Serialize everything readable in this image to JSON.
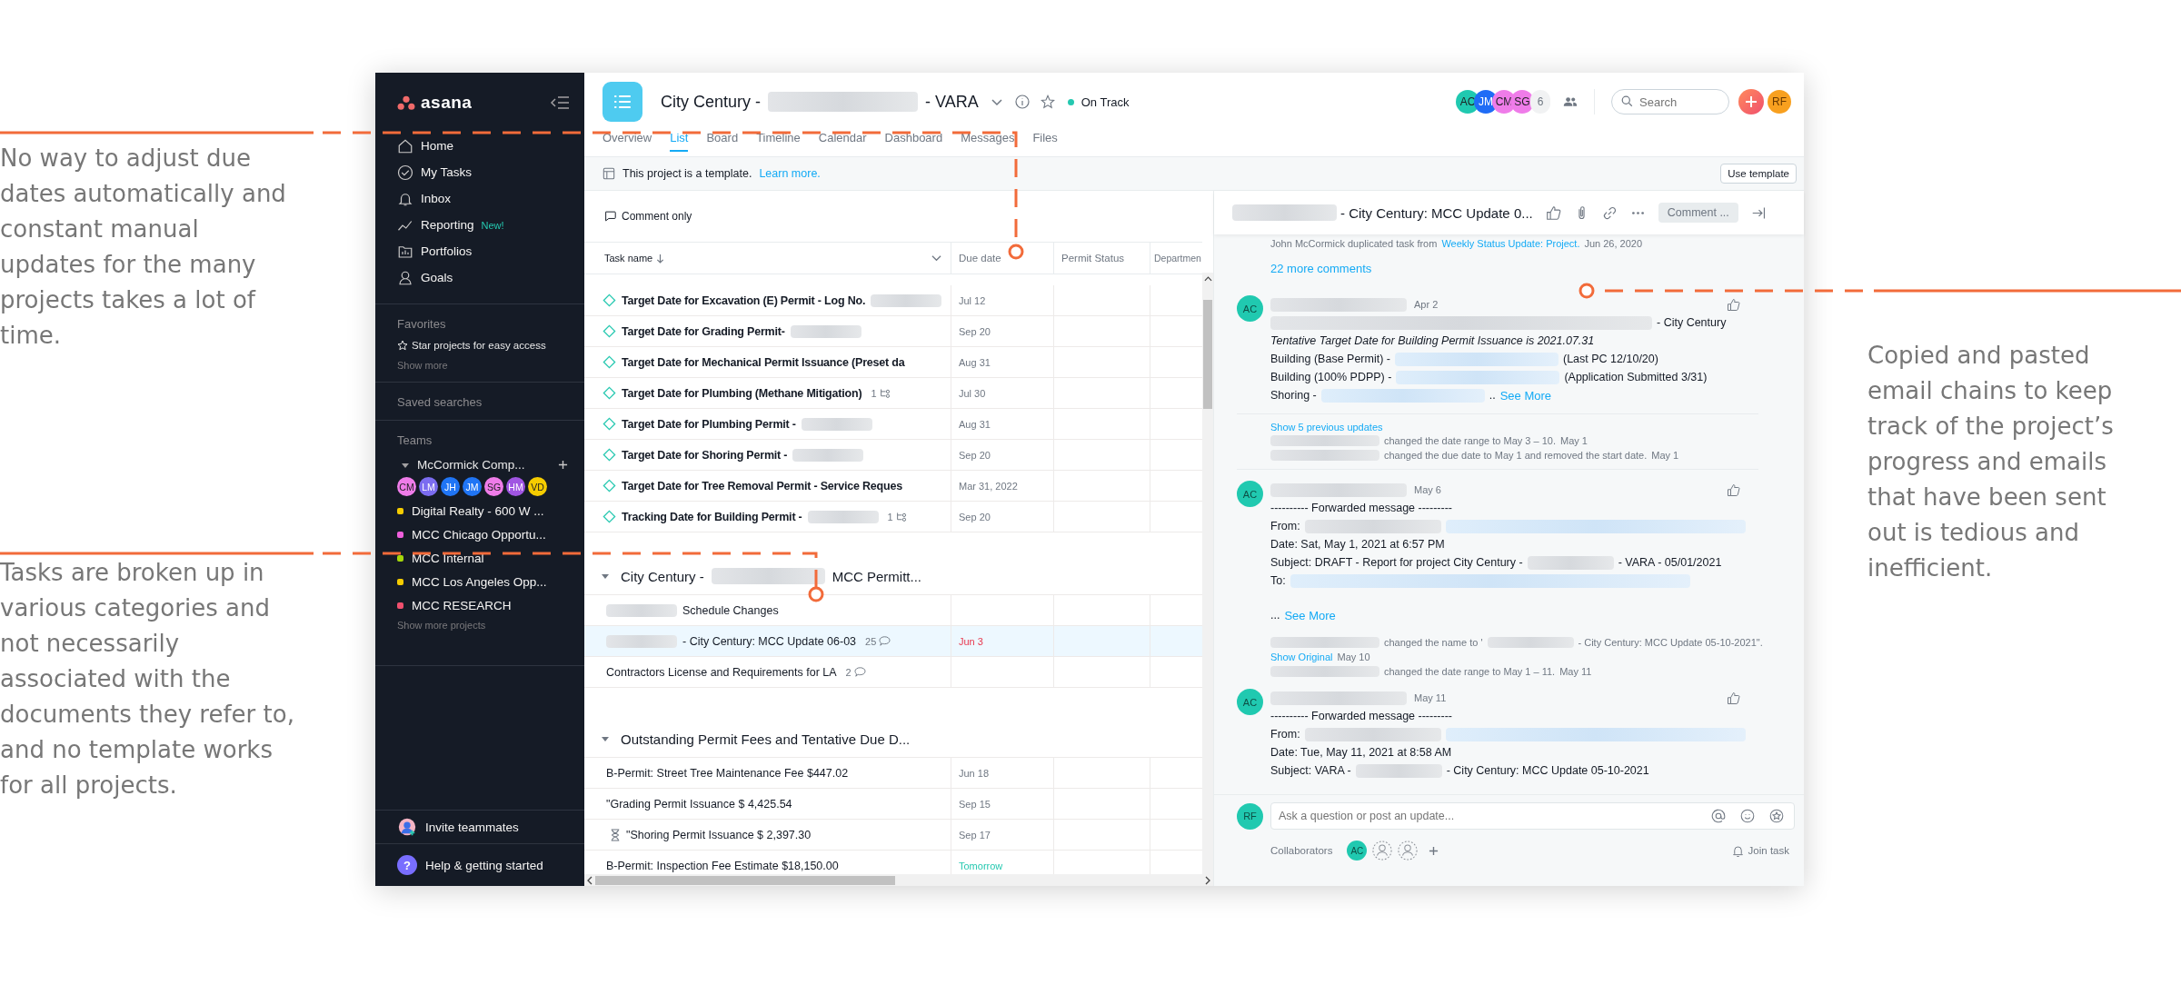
{
  "annotations_left": [
    {
      "text": "No way to adjust due dates automatically and constant manual updates for the many projects takes a lot of time."
    },
    {
      "text": "Tasks are broken up in various categories and not necessarily associated with the documents they refer to, and no template works for all projects."
    }
  ],
  "annotation_right": {
    "text": "Copied and pasted email chains to keep track of the project’s progress and emails that have been sent out is tedious and inefficient."
  },
  "sidebar": {
    "logo": "asana",
    "nav": [
      {
        "label": "Home"
      },
      {
        "label": "My Tasks"
      },
      {
        "label": "Inbox"
      },
      {
        "label": "Reporting",
        "badge": "New!"
      },
      {
        "label": "Portfolios"
      },
      {
        "label": "Goals"
      }
    ],
    "favorites": {
      "title": "Favorites",
      "hint": "Star projects for easy access",
      "show_more": "Show more"
    },
    "saved_searches": "Saved searches",
    "teams": {
      "title": "Teams",
      "team": "McCormick Comp...",
      "members": [
        {
          "initials": "CM",
          "color": "#ef7ce9"
        },
        {
          "initials": "LM",
          "color": "#7b6cf0"
        },
        {
          "initials": "JH",
          "color": "#2075f5"
        },
        {
          "initials": "JM",
          "color": "#2075f5"
        },
        {
          "initials": "SG",
          "color": "#ef7ce9"
        },
        {
          "initials": "HM",
          "color": "#a055e2"
        },
        {
          "initials": "VD",
          "color": "#f5cc00"
        }
      ],
      "projects": [
        {
          "name": "Digital Realty - 600 W ...",
          "color": "#f5cc00"
        },
        {
          "name": "MCC Chicago Opportu...",
          "color": "#ef5fdc"
        },
        {
          "name": "MCC Internal",
          "color": "#a5d70a"
        },
        {
          "name": "MCC Los Angeles Opp...",
          "color": "#f5cc00"
        },
        {
          "name": "MCC RESEARCH",
          "color": "#f0506e"
        }
      ],
      "show_more": "Show more projects"
    },
    "invite": "Invite teammates",
    "help_glyph": "?",
    "help": "Help & getting started"
  },
  "header": {
    "title": "City Century -",
    "redacted": true,
    "title_end": "- VARA",
    "status": "On Track",
    "tabs": [
      {
        "label": "Overview",
        "selected": false
      },
      {
        "label": "List",
        "selected": true
      },
      {
        "label": "Board",
        "selected": false
      },
      {
        "label": "Timeline",
        "selected": false
      },
      {
        "label": "Calendar",
        "selected": false
      },
      {
        "label": "Dashboard",
        "selected": false
      },
      {
        "label": "Messages",
        "selected": false
      },
      {
        "label": "Files",
        "selected": false
      }
    ],
    "members": [
      {
        "initials": "AC",
        "color": "#20c9b0"
      },
      {
        "initials": "JM",
        "color": "#1f6cf6"
      },
      {
        "initials": "CM",
        "color": "#ef7ce9"
      },
      {
        "initials": "SG",
        "color": "#ef7ce9"
      }
    ],
    "member_count": "6",
    "search": {
      "placeholder": "Search"
    },
    "user": "RF"
  },
  "banner": {
    "text": "This project is a template.",
    "link": "Learn more.",
    "button": "Use template"
  },
  "list": {
    "filter": "Comment only",
    "columns": [
      "Task name",
      "Due date",
      "Permit Status",
      "Departmen"
    ],
    "groups": [
      {
        "rows": [
          {
            "kind": "milestone",
            "name": "Target Date for Excavation (E) Permit - Log No.",
            "redacted_after": true,
            "due": "Jul 12",
            "selected": false
          },
          {
            "kind": "milestone",
            "name": "Target Date for Grading Permit-",
            "redacted_after": true,
            "due": "Sep 20",
            "selected": false
          },
          {
            "kind": "milestone",
            "name": "Target Date for Mechanical Permit Issuance (Preset da",
            "due": "Aug 31",
            "selected": false
          },
          {
            "kind": "milestone",
            "name": "Target Date for Plumbing (Methane Mitigation)",
            "subtasks": "1",
            "due": "Jul 30",
            "selected": false
          },
          {
            "kind": "milestone",
            "name": "Target Date for Plumbing Permit -",
            "redacted_after": true,
            "due": "Aug 31",
            "selected": false
          },
          {
            "kind": "milestone",
            "name": "Target Date for Shoring Permit -",
            "redacted_after": true,
            "due": "Sep 20",
            "selected": false
          },
          {
            "kind": "milestone",
            "name": "Target Date for Tree Removal Permit - Service Reques",
            "due": "Mar 31, 2022",
            "selected": false
          },
          {
            "kind": "milestone",
            "name": "Tracking Date for Building Permit -",
            "redacted_after": true,
            "subtasks": "1",
            "due": "Sep 20",
            "selected": false
          }
        ]
      },
      {
        "title": "City Century -",
        "redacted": true,
        "title_end": "MCC Permitt...",
        "expanded": true,
        "rows": [
          {
            "kind": "task",
            "name": "Schedule Changes",
            "redacted_before": true,
            "selected": false
          },
          {
            "kind": "task",
            "name": "- City Century: MCC Update 06-03",
            "redacted_before": true,
            "comments": "25",
            "due": "Jun 3",
            "overdue": true,
            "selected": true
          },
          {
            "kind": "task",
            "name": "Contractors License and Requirements for LA",
            "comments": "2",
            "selected": false
          }
        ]
      },
      {
        "title": "Outstanding Permit Fees and Tentative Due D...",
        "expanded": true,
        "rows": [
          {
            "kind": "task",
            "name": "B-Permit: Street Tree Maintenance Fee $447.02",
            "due": "Jun 18",
            "selected": false
          },
          {
            "kind": "task",
            "name": "\"Grading Permit Issuance $ 4,425.54",
            "due": "Sep 15",
            "selected": false
          },
          {
            "kind": "waiting",
            "name": "\"Shoring Permit Issuance $ 2,397.30",
            "due": "Sep 17",
            "selected": false
          },
          {
            "kind": "task",
            "name": "B-Permit: Inspection Fee Estimate $18,150.00",
            "due": "Tomorrow",
            "due_soon": true,
            "selected": false
          }
        ]
      }
    ]
  },
  "detail": {
    "title": "- City Century: MCC Update 0...",
    "redacted": true,
    "pill": "Comment ...",
    "activity": [
      {
        "kind": "note",
        "segs": [
          {
            "text": "John McCormick duplicated task from"
          },
          {
            "link": "Weekly Status Update: Project."
          },
          {
            "text": "Jun 26, 2020"
          }
        ]
      },
      {
        "kind": "more",
        "text": "22 more comments"
      },
      {
        "kind": "comment",
        "initials": "AC",
        "time": "Apr 2",
        "lines": [
          {
            "kind": "plain",
            "segs": [
              {
                "kind": "blurred_line"
              },
              {
                "text": "- City Century"
              }
            ]
          },
          {
            "kind": "emphasis",
            "segs": [
              {
                "text": "Tentative Target Date for Building Permit Issuance is 2021.07.31"
              }
            ]
          },
          {
            "kind": "plain",
            "segs": [
              {
                "text": "Building (Base Permit) -"
              },
              {
                "kind": "blurred_link"
              },
              {
                "text": "(Last PC 12/10/20)"
              }
            ]
          },
          {
            "kind": "plain",
            "segs": [
              {
                "text": "Building (100% PDPP) -"
              },
              {
                "kind": "blurred_link"
              },
              {
                "text": "(Application Submitted 3/31)"
              }
            ]
          },
          {
            "kind": "plain",
            "segs": [
              {
                "text": "Shoring -"
              },
              {
                "kind": "blurred_link"
              },
              {
                "text": ".."
              },
              {
                "link": "See More"
              }
            ]
          }
        ]
      },
      {
        "kind": "updates",
        "toggle": "Show 5 previous updates",
        "items": [
          {
            "segs": [
              {
                "kind": "blurred_name"
              },
              {
                "text": "changed the date range to May 3 – 10."
              },
              {
                "text": "May 1"
              }
            ]
          },
          {
            "segs": [
              {
                "kind": "blurred_name"
              },
              {
                "text": "changed the due date to May 1 and removed the start date."
              },
              {
                "text": "May 1"
              }
            ]
          }
        ]
      },
      {
        "kind": "comment",
        "initials": "AC",
        "time": "May 6",
        "lines": [
          {
            "kind": "plain",
            "segs": [
              {
                "text": "---------- Forwarded message ---------"
              }
            ]
          },
          {
            "kind": "plain",
            "segs": [
              {
                "text": "From:"
              },
              {
                "kind": "blurred_sender"
              },
              {
                "kind": "blurred_email"
              }
            ]
          },
          {
            "kind": "plain",
            "segs": [
              {
                "text": "Date: Sat, May 1, 2021 at 6:57 PM"
              }
            ]
          },
          {
            "kind": "plain",
            "segs": [
              {
                "text": "Subject: DRAFT - Report for project City Century -"
              },
              {
                "kind": "blurred_word"
              },
              {
                "text": "- VARA - 05/01/2021"
              }
            ]
          },
          {
            "kind": "plain",
            "segs": [
              {
                "text": "To:"
              },
              {
                "kind": "blurred_recipients"
              }
            ]
          },
          {
            "kind": "after_gap",
            "segs": [
              {
                "text": "..."
              },
              {
                "link": "See More"
              }
            ]
          }
        ]
      },
      {
        "kind": "updates",
        "items": [
          {
            "segs": [
              {
                "kind": "blurred_name"
              },
              {
                "text": "changed the name to '"
              },
              {
                "kind": "blurred_word"
              },
              {
                "text": "- City Century: MCC Update 05-10-2021\"."
              }
            ]
          },
          {
            "segs": [
              {
                "link": "Show Original"
              },
              {
                "text": "May 10"
              }
            ]
          },
          {
            "segs": [
              {
                "kind": "blurred_name"
              },
              {
                "text": "changed the date range to May 1 – 11."
              },
              {
                "text": "May 11"
              }
            ]
          }
        ]
      },
      {
        "kind": "comment",
        "initials": "AC",
        "time": "May 11",
        "lines": [
          {
            "kind": "plain",
            "segs": [
              {
                "text": "---------- Forwarded message ---------"
              }
            ]
          },
          {
            "kind": "plain",
            "segs": [
              {
                "text": "From:"
              },
              {
                "kind": "blurred_sender"
              },
              {
                "kind": "blurred_email"
              }
            ]
          },
          {
            "kind": "plain",
            "segs": [
              {
                "text": "Date: Tue, May 11, 2021 at 8:58 AM"
              }
            ]
          },
          {
            "kind": "plain",
            "segs": [
              {
                "text": "Subject: VARA -"
              },
              {
                "kind": "blurred_word"
              },
              {
                "text": "- City Century: MCC Update 05-10-2021"
              }
            ]
          }
        ]
      }
    ],
    "composer": {
      "initials": "RF",
      "placeholder": "Ask a question or post an update...",
      "collaborators_label": "Collaborators",
      "collaborators": [
        "AC"
      ],
      "join": "Join task"
    }
  }
}
